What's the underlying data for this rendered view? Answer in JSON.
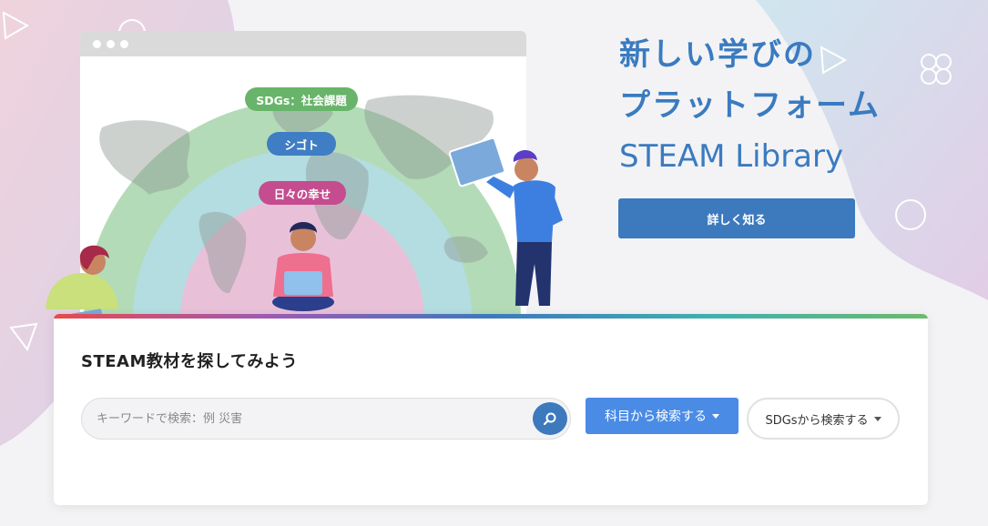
{
  "hero": {
    "title_line1": "新しい学びの",
    "title_line2": "プラットフォーム",
    "title_line3": "STEAM Library",
    "cta_label": "詳しく知る"
  },
  "illustration": {
    "ring_outer_label": "SDGs：社会課題",
    "ring_middle_label": "シゴト",
    "ring_inner_label": "日々の幸せ"
  },
  "search": {
    "title": "STEAM教材を探してみよう",
    "placeholder": "キーワードで検索：例 災害",
    "value": "",
    "subject_button_label": "科目から検索する",
    "sdgs_button_label": "SDGsから検索する"
  },
  "icons": {
    "search_button": "search-icon",
    "dropdown": "caret-down-icon"
  },
  "colors": {
    "brand_blue": "#3d79bd",
    "accent_blue": "#4a8be6",
    "ring_green": "#b3dbb7",
    "ring_teal": "#b4dde1",
    "ring_pink": "#e8c1d9",
    "pill_green": "#68b46a",
    "pill_blue": "#3f7dc4",
    "pill_pink": "#c44c8f"
  }
}
